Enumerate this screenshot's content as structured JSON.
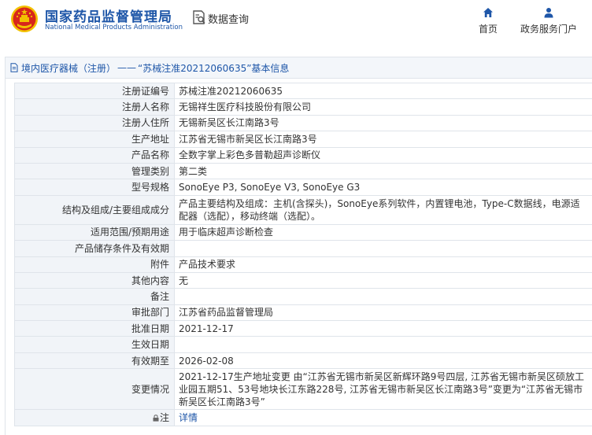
{
  "header": {
    "logo_cn": "国家药品监督管理局",
    "logo_en": "National Medical Products Administration",
    "search_label": "数据查询",
    "nav": [
      {
        "label": "首页",
        "icon": "home-icon"
      },
      {
        "label": "政务服务门户",
        "icon": "user-icon"
      }
    ]
  },
  "breadcrumb": {
    "link": "境内医疗器械（注册）",
    "separator": "——",
    "title": "“苏械注准20212060635”基本信息"
  },
  "colors": {
    "brand_blue": "#1e56a8",
    "key_bg": "#f1f4f8",
    "border": "#dfe4ea",
    "emblem_red": "#d7261c",
    "emblem_gold": "#f2c200"
  },
  "rows": [
    {
      "key": "注册证编号",
      "value": "苏械注准20212060635"
    },
    {
      "key": "注册人名称",
      "value": "无锡祥生医疗科技股份有限公司"
    },
    {
      "key": "注册人住所",
      "value": "无锡新吴区长江南路3号"
    },
    {
      "key": "生产地址",
      "value": "江苏省无锡市新吴区长江南路3号"
    },
    {
      "key": "产品名称",
      "value": "全数字掌上彩色多普勒超声诊断仪"
    },
    {
      "key": "管理类别",
      "value": "第二类"
    },
    {
      "key": "型号规格",
      "value": "SonoEye P3, SonoEye V3, SonoEye G3"
    },
    {
      "key": "结构及组成/主要组成成分",
      "value": "产品主要结构及组成：主机(含探头)，SonoEye系列软件，内置锂电池，Type-C数据线，电源适配器（选配），移动终端（选配）。"
    },
    {
      "key": "适用范围/预期用途",
      "value": "用于临床超声诊断检查"
    },
    {
      "key": "产品储存条件及有效期",
      "value": ""
    },
    {
      "key": "附件",
      "value": "产品技术要求"
    },
    {
      "key": "其他内容",
      "value": "无"
    },
    {
      "key": "备注",
      "value": ""
    },
    {
      "key": "审批部门",
      "value": "江苏省药品监督管理局"
    },
    {
      "key": "批准日期",
      "value": "2021-12-17"
    },
    {
      "key": "生效日期",
      "value": ""
    },
    {
      "key": "有效期至",
      "value": "2026-02-08"
    },
    {
      "key": "变更情况",
      "value": "2021-12-17生产地址变更 由“江苏省无锡市新吴区新辉环路9号四层, 江苏省无锡市新吴区硕放工业园五期51、53号地块长江东路228号, 江苏省无锡市新吴区长江南路3号”变更为“江苏省无锡市新吴区长江南路3号”"
    },
    {
      "key": "注",
      "value": "详情"
    }
  ]
}
